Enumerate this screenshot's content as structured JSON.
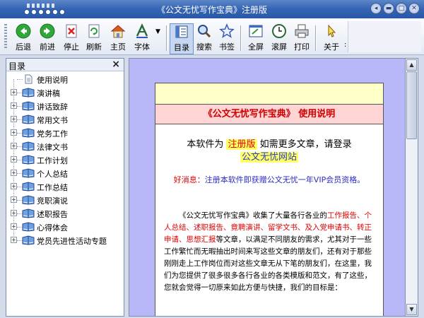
{
  "window": {
    "title": "《公文无忧写作宝典》注册版"
  },
  "toolbar": {
    "buttons": [
      {
        "id": "back",
        "label": "后退",
        "icon": "back-arrow-icon"
      },
      {
        "id": "forward",
        "label": "前进",
        "icon": "forward-arrow-icon"
      },
      {
        "id": "stop",
        "label": "停止",
        "icon": "stop-icon"
      },
      {
        "id": "refresh",
        "label": "刷新",
        "icon": "refresh-icon"
      },
      {
        "id": "home",
        "label": "主页",
        "icon": "home-icon"
      },
      {
        "id": "font",
        "label": "字体",
        "icon": "font-icon"
      },
      {
        "id": "toc",
        "label": "目录",
        "icon": "toc-icon"
      },
      {
        "id": "search",
        "label": "搜索",
        "icon": "search-icon"
      },
      {
        "id": "bookmark",
        "label": "书签",
        "icon": "star-icon"
      },
      {
        "id": "fullscreen",
        "label": "全屏",
        "icon": "fullscreen-icon"
      },
      {
        "id": "autoscroll",
        "label": "滚屏",
        "icon": "clock-icon"
      },
      {
        "id": "print",
        "label": "打印",
        "icon": "printer-icon"
      },
      {
        "id": "about",
        "label": "关于",
        "icon": "cursor-icon"
      }
    ]
  },
  "leftpanel": {
    "title": "目录",
    "close": "×",
    "items": [
      {
        "label": "使用说明",
        "type": "page"
      },
      {
        "label": "演讲稿",
        "type": "book"
      },
      {
        "label": "讲话致辞",
        "type": "book"
      },
      {
        "label": "常用文书",
        "type": "book"
      },
      {
        "label": "党务工作",
        "type": "book"
      },
      {
        "label": "法律文书",
        "type": "book"
      },
      {
        "label": "工作计划",
        "type": "book"
      },
      {
        "label": "个人总结",
        "type": "book"
      },
      {
        "label": "工作总结",
        "type": "book"
      },
      {
        "label": "竞职演说",
        "type": "book"
      },
      {
        "label": "述职报告",
        "type": "book"
      },
      {
        "label": "心得体会",
        "type": "book"
      },
      {
        "label": "党员先进性活动专题",
        "type": "book"
      }
    ]
  },
  "content": {
    "doc_title": "《公文无忧写作宝典》  使用说明",
    "reg_prefix": "本软件为",
    "reg_version": "注册版",
    "reg_suffix": "如需更多文章，请登录",
    "site_name": "公文无忧网站",
    "good_news_label": "好消息：",
    "good_news_text": "注册本软件即获赠公文无忧一年VIP会员资格。",
    "intro_part1": "《公文无忧写作宝典》收集了大量各行各业的",
    "intro_red": "工作报告、个人总结、述职报告、竟聘演讲、留学文书、及入党申请书、转正申请、思想汇报",
    "intro_part2": "等文章，以满足不同朋友的需求，尤其对于一些工作繁忙而无暇抽出时间来写这些文章的朋友们，还有对于那些刚刚走上工作岗位而对这些文章无从下笔的朋友们，在这里，我们为您提供了很多很多各行各业的各类模版和范文，有了这些，您就会觉得一切原来如此方便与快捷，我们的目标是："
  },
  "colors": {
    "title_bar": "#3464b4",
    "content_bg": "#b8b8f8",
    "accent_red": "#e00000",
    "accent_blue": "#2a3cc8",
    "highlight": "#ffff66"
  }
}
